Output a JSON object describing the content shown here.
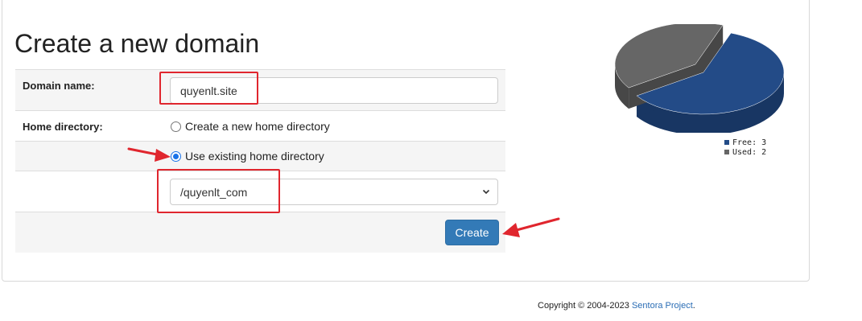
{
  "page": {
    "title": "Create a new domain"
  },
  "form": {
    "domain_label": "Domain name:",
    "domain_value": "quyenlt.site",
    "home_label": "Home directory:",
    "option_new": "Create a new home directory",
    "option_existing": "Use existing home directory",
    "selected_option": "existing",
    "directory_value": "/quyenlt_com",
    "create_label": "Create"
  },
  "chart_data": {
    "type": "pie",
    "categories": [
      "Free",
      "Used"
    ],
    "values": [
      3,
      2
    ],
    "colors": [
      "#234b87",
      "#666666"
    ],
    "legend": [
      "Free: 3",
      "Used: 2"
    ],
    "legend_position": "bottom-right"
  },
  "footer": {
    "copyright": "Copyright © 2004-2023",
    "link_text": "Sentora Project",
    "suffix": "."
  },
  "annotations": {
    "highlight_color": "#e0262e"
  }
}
